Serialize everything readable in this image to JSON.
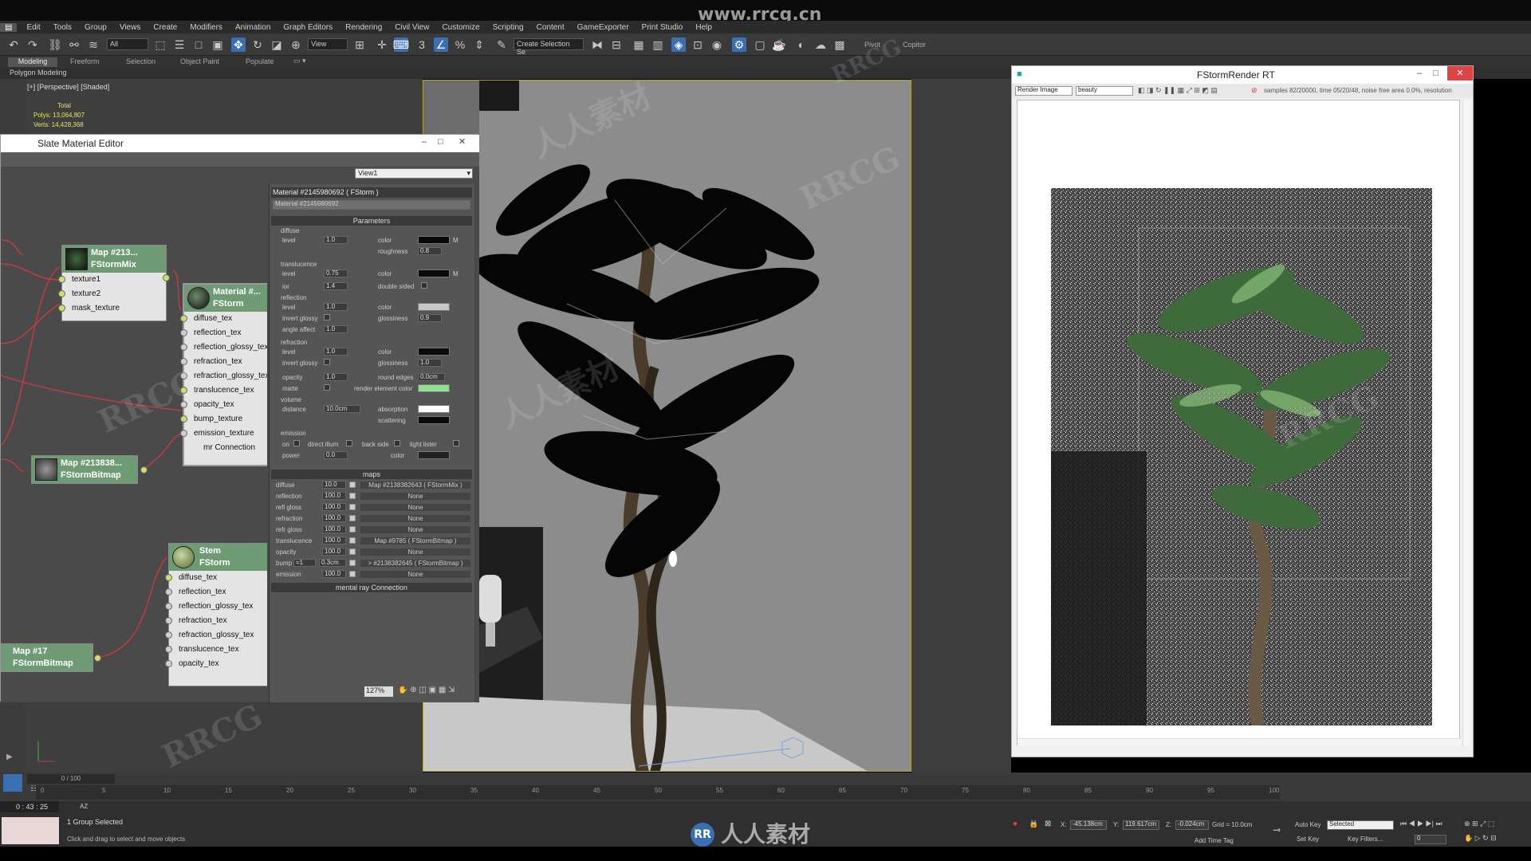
{
  "watermark_url": "www.rrcg.cn",
  "watermark_text": "RRCG",
  "watermark_cn": "人人素材",
  "menu": [
    "Edit",
    "Tools",
    "Group",
    "Views",
    "Create",
    "Modifiers",
    "Animation",
    "Graph Editors",
    "Rendering",
    "Civil View",
    "Customize",
    "Scripting",
    "Content",
    "GameExporter",
    "Print Studio",
    "Help"
  ],
  "toolbar": {
    "filter_value": "All",
    "view_value": "View",
    "selection_set": "Create Selection Se",
    "pivot_label": "Pivot",
    "copitor_label": "Copitor"
  },
  "ribbon": {
    "tabs": [
      "Modeling",
      "Freeform",
      "Selection",
      "Object Paint",
      "Populate"
    ],
    "sub": "Polygon Modeling"
  },
  "viewport": {
    "label": "[+] [Perspective] [Shaded]",
    "total_label": "Total",
    "polys": "Polys:  13,064,807",
    "verts": "Verts:  14,428,368"
  },
  "slate": {
    "title": "Slate Material Editor",
    "view_select": "View1",
    "zoom": "127%",
    "nodes": [
      {
        "title": "Map #213...",
        "subtitle": "FStormMix",
        "slots": [
          "texture1",
          "texture2",
          "mask_texture"
        ]
      },
      {
        "title": "Material #...",
        "subtitle": "FStorm",
        "slots": [
          "diffuse_tex",
          "reflection_tex",
          "reflection_glossy_tex",
          "refraction_tex",
          "refraction_glossy_tex",
          "translucence_tex",
          "opacity_tex",
          "bump_texture",
          "emission_texture",
          "mr Connection"
        ]
      },
      {
        "title": "Map #213838...",
        "subtitle": "FStormBitmap",
        "slots": []
      },
      {
        "title": "Stem",
        "subtitle": "FStorm",
        "slots": [
          "diffuse_tex",
          "reflection_tex",
          "reflection_glossy_tex",
          "refraction_tex",
          "refraction_glossy_tex",
          "translucence_tex",
          "opacity_tex"
        ]
      },
      {
        "title": "Map #17",
        "subtitle": "FStormBitmap",
        "slots": []
      }
    ],
    "params": {
      "header": "Material #2145980692  ( FStorm )",
      "name": "Material #2145980692",
      "section_params": "Parameters",
      "diffuse": {
        "group": "diffuse",
        "level_label": "level",
        "level": "1.0",
        "color_label": "color",
        "roughness_label": "roughness",
        "roughness": "0.8",
        "m": "M"
      },
      "translucence": {
        "group": "translucence",
        "level_label": "level",
        "level": "0.75",
        "color_label": "color",
        "ior_label": "ior",
        "ior": "1.4",
        "double_sided": "double sided",
        "m": "M"
      },
      "reflection": {
        "group": "reflection",
        "level_label": "level",
        "level": "1.0",
        "color_label": "color",
        "invert_glossy": "invert glossy",
        "glossiness_label": "glossiness",
        "glossiness": "0.9",
        "angle_affect": "angle affect",
        "angle_value": "1.0"
      },
      "refraction": {
        "group": "refraction",
        "level_label": "level",
        "level": "1.0",
        "color_label": "color",
        "invert_glossy": "invert glossy",
        "glossiness_label": "glossiness",
        "glossiness": "1.0",
        "opacity_label": "opacity",
        "opacity": "1.0",
        "round_edges": "round edges",
        "round_value": "0.0cm",
        "matte": "matte",
        "render_element_color": "render element color"
      },
      "volume": {
        "group": "volume",
        "distance_label": "distance",
        "distance": "10.0cm",
        "absorption": "absorption",
        "scattering": "scattering"
      },
      "emission": {
        "group": "emission",
        "on": "on",
        "direct_illum": "direct illum",
        "back_side": "back side",
        "light_lister": "light lister",
        "power_label": "power",
        "power": "0.0",
        "color_label": "color"
      },
      "section_maps": "maps",
      "maps": [
        {
          "name": "diffuse",
          "value": "10.0",
          "map": "Map #2138382643  ( FStormMix )"
        },
        {
          "name": "reflection",
          "value": "100.0",
          "map": "None"
        },
        {
          "name": "refl gloss",
          "value": "100.0",
          "map": "None"
        },
        {
          "name": "refraction",
          "value": "100.0",
          "map": "None"
        },
        {
          "name": "refr gloss",
          "value": "100.0",
          "map": "None"
        },
        {
          "name": "translucence",
          "value": "100.0",
          "map": "Map #9785  ( FStormBitmap )"
        },
        {
          "name": "opacity",
          "value": "100.0",
          "map": "None"
        },
        {
          "name": "bump",
          "value": "0.3cm",
          "map": "> #2138382645  ( FStormBitmap )",
          "extra": "=1"
        },
        {
          "name": "emission",
          "value": "100.0",
          "map": "None"
        }
      ],
      "mr_connection": "mental ray Connection"
    }
  },
  "fstorm": {
    "title": "FStormRender RT",
    "mode": "Render Image",
    "channel": "beauty",
    "stats": "samples 82/20000,  time 05/20/48,  noise free area 0.0%,  resolution"
  },
  "timeline": {
    "frame": "0 / 100",
    "ticks": [
      "0",
      "5",
      "10",
      "15",
      "20",
      "25",
      "30",
      "35",
      "40",
      "45",
      "50",
      "55",
      "60",
      "65",
      "70",
      "75",
      "80",
      "85",
      "90",
      "95",
      "100"
    ]
  },
  "status": {
    "time": "0 : 43 : 25",
    "ax": "AZ",
    "selected": "1 Group Selected",
    "hint": "Click and drag to select and move objects",
    "x": "-45.138cm",
    "y": "119.617cm",
    "z": "-0.024cm",
    "grid": "Grid = 10.0cm",
    "autokey": "Auto Key",
    "autokey_value": "Selected",
    "setkey": "Set Key",
    "keyfilters": "Key Filters...",
    "addtimetag": "Add Time Tag",
    "frame_field": "0"
  }
}
